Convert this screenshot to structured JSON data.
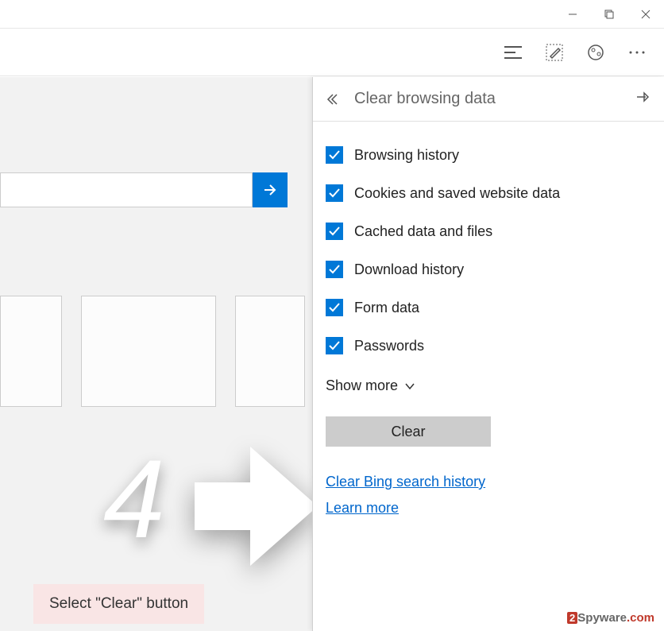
{
  "panel": {
    "title": "Clear browsing data",
    "checks": [
      {
        "label": "Browsing history"
      },
      {
        "label": "Cookies and saved website data"
      },
      {
        "label": "Cached data and files"
      },
      {
        "label": "Download history"
      },
      {
        "label": "Form data"
      },
      {
        "label": "Passwords"
      }
    ],
    "show_more": "Show more",
    "clear_button": "Clear",
    "link_bing": "Clear Bing search history",
    "link_learn": "Learn more"
  },
  "step": {
    "number": "4",
    "instruction": "Select \"Clear\" button"
  },
  "watermark": {
    "brand1_num": "2",
    "brand1_text": "Spyware",
    "brand1_dot": ".com"
  }
}
